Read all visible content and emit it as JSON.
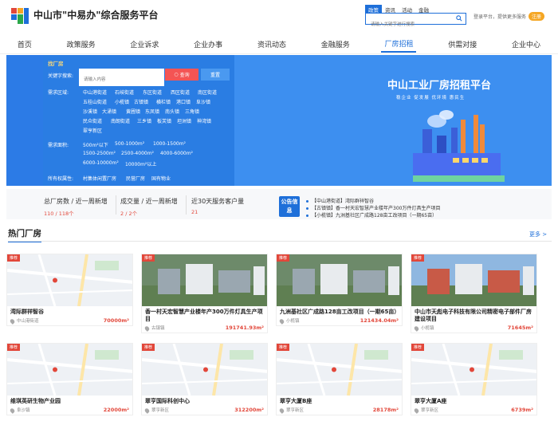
{
  "header": {
    "title": "中山市\"中易办\"综合服务平台",
    "search_tabs": [
      "政策",
      "资讯",
      "活动",
      "金融"
    ],
    "search_placeholder": "请输入关键字进行搜索",
    "login_text": "登录平台，提供更多服务",
    "badge": "注册"
  },
  "nav": [
    "首页",
    "政策服务",
    "企业诉求",
    "企业办事",
    "资讯动态",
    "金融服务",
    "厂房招租",
    "供需对接",
    "企业中心"
  ],
  "nav_active": "厂房招租",
  "finder": {
    "title": "找厂房",
    "keyword_label": "关键字搜索:",
    "keyword_placeholder": "请输入内容",
    "search_button": "查询",
    "reset_button": "重置",
    "region_label": "需求区域:",
    "regions_row1": [
      "中山港街道",
      "石岐街道",
      "东区街道",
      "西区街道",
      "南区街道"
    ],
    "regions_row2": [
      "五桂山街道",
      "小榄镇",
      "古镇镇",
      "横栏镇",
      "港口镇",
      "阜沙镇"
    ],
    "regions_row3": [
      "沙溪镇",
      "大涌镇",
      "黄圃镇",
      "东凤镇",
      "南头镇",
      "三角镇"
    ],
    "regions_row4": [
      "民众街道",
      "南朗街道",
      "三乡镇",
      "板芙镇",
      "坦洲镇",
      "神湾镇"
    ],
    "regions_row5": [
      "翠亨新区"
    ],
    "area_label": "需求面积:",
    "areas_row1": [
      "500m²以下",
      "500-1000m²",
      "1000-1500m²"
    ],
    "areas_row2": [
      "1500-2500m²",
      "2500-4000m²",
      "4000-6000m²"
    ],
    "areas_row3": [
      "6000-10000m²",
      "10000m²以上"
    ],
    "owner_label": "所有权属性:",
    "owners": [
      "村集体闲置厂房",
      "民营厂房",
      "国有物业"
    ]
  },
  "hero": {
    "title": "中山工业厂房招租平台",
    "subtitle": "稳企业 促发展 优环境 惠民生"
  },
  "stats": {
    "s1_label": "总厂房数 / 近一周新增",
    "s1_value": "110 / 118个",
    "s2_label": "成交量 / 近一周新增",
    "s2_value": "2 / 2个",
    "s3_label": "近30天服务客户量",
    "s3_value": "21"
  },
  "notice": {
    "badge": "公告信息",
    "items": [
      "【中山港街道】湾际群祥智谷",
      "【古镇镇】香一村天宏智慧产业楼年产300万件灯具生产项目",
      "【小榄镇】九洲基社区广成路128亩工改项目（一期65亩）"
    ]
  },
  "hot": {
    "title": "热门厂房",
    "more": "更多 >"
  },
  "cards": [
    {
      "tag": "推荐",
      "name": "湾际群祥智谷",
      "town": "中山港街道",
      "area": "70000m²"
    },
    {
      "tag": "推荐",
      "name": "香一村天宏智慧产业楼年产300万件灯具生产项目",
      "town": "古镇镇",
      "area": "191741.93m²"
    },
    {
      "tag": "推荐",
      "name": "九洲基社区广成路128亩工改项目（一期65亩）",
      "town": "小榄镇",
      "area": "121434.04m²"
    },
    {
      "tag": "推荐",
      "name": "中山市天彪电子科技有限公司精密电子部件厂房建设项目",
      "town": "小榄镇",
      "area": "71645m²"
    },
    {
      "tag": "推荐",
      "name": "维琪英研生物产业园",
      "town": "阜沙镇",
      "area": "22000m²"
    },
    {
      "tag": "推荐",
      "name": "翠亨国际科创中心",
      "town": "翠亨新区",
      "area": "312200m²"
    },
    {
      "tag": "推荐",
      "name": "翠亨大厦B座",
      "town": "翠亨新区",
      "area": "28178m²"
    },
    {
      "tag": "推荐",
      "name": "翠亨大厦A座",
      "town": "翠亨新区",
      "area": "6739m²"
    }
  ],
  "colors": {
    "primary": "#1e6fd9",
    "banner": "#3d8ff0",
    "accent_red": "#e2473a",
    "gold": "#f8d87a"
  }
}
